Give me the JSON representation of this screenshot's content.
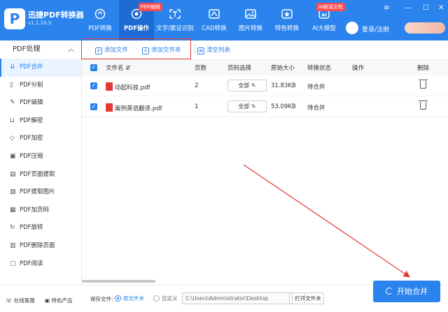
{
  "app": {
    "name": "迅捷PDF转换器",
    "version": "v1.1.10.3",
    "logo_letter": "P"
  },
  "nav": [
    {
      "label": "PDF转换",
      "icon": "refresh-icon",
      "active": false
    },
    {
      "label": "PDF操作",
      "icon": "target-icon",
      "active": true,
      "badge": "PDF编辑"
    },
    {
      "label": "文字/票证识别",
      "icon": "scan-text-icon",
      "active": false
    },
    {
      "label": "CAD转换",
      "icon": "cad-icon",
      "active": false
    },
    {
      "label": "图片转换",
      "icon": "image-icon",
      "active": false
    },
    {
      "label": "特色转换",
      "icon": "star-icon",
      "active": false
    },
    {
      "label": "AI大模型",
      "icon": "ai-icon",
      "active": false,
      "badge": "AI解读文档"
    }
  ],
  "header": {
    "login_label": "登录/注册"
  },
  "sidebar": {
    "title": "PDF处理",
    "items": [
      {
        "label": "PDF合并",
        "icon": "merge-icon",
        "active": true
      },
      {
        "label": "PDF分割",
        "icon": "split-icon"
      },
      {
        "label": "PDF编辑",
        "icon": "edit-icon"
      },
      {
        "label": "PDF解密",
        "icon": "unlock-icon"
      },
      {
        "label": "PDF加密",
        "icon": "shield-icon"
      },
      {
        "label": "PDF压缩",
        "icon": "compress-icon"
      },
      {
        "label": "PDF页面提取",
        "icon": "extract-page-icon"
      },
      {
        "label": "PDF提取图片",
        "icon": "extract-image-icon"
      },
      {
        "label": "PDF加页码",
        "icon": "page-number-icon"
      },
      {
        "label": "PDF旋转",
        "icon": "rotate-icon"
      },
      {
        "label": "PDF删除页面",
        "icon": "delete-page-icon"
      },
      {
        "label": "PDF阅读",
        "icon": "read-icon"
      }
    ],
    "footer": {
      "service": "在线客服",
      "products": "特色产品"
    }
  },
  "toolbar": {
    "add_file": "添加文件",
    "add_folder": "添加文件夹",
    "clear_list": "清空列表"
  },
  "table": {
    "headers": {
      "name": "文件名",
      "pages": "页数",
      "page_select": "页码选择",
      "size": "原始大小",
      "status": "转换状态",
      "action": "操作",
      "delete": "删除"
    },
    "rows": [
      {
        "name": "动起科技.pdf",
        "pages": "2",
        "page_select": "全部",
        "size": "31.83KB",
        "status": "待合并"
      },
      {
        "name": "案例英语翻译.pdf",
        "pages": "1",
        "page_select": "全部",
        "size": "53.09KB",
        "status": "待合并"
      }
    ]
  },
  "bottom": {
    "save_label": "保存文件:",
    "option_source": "原文件夹",
    "option_custom": "自定义",
    "path": "C:\\Users\\Administrator\\Desktop",
    "dots": "···",
    "open_folder": "打开文件夹",
    "start": "开始合并"
  },
  "colors": {
    "brand": "#2b84ee",
    "highlight": "#e53935"
  }
}
